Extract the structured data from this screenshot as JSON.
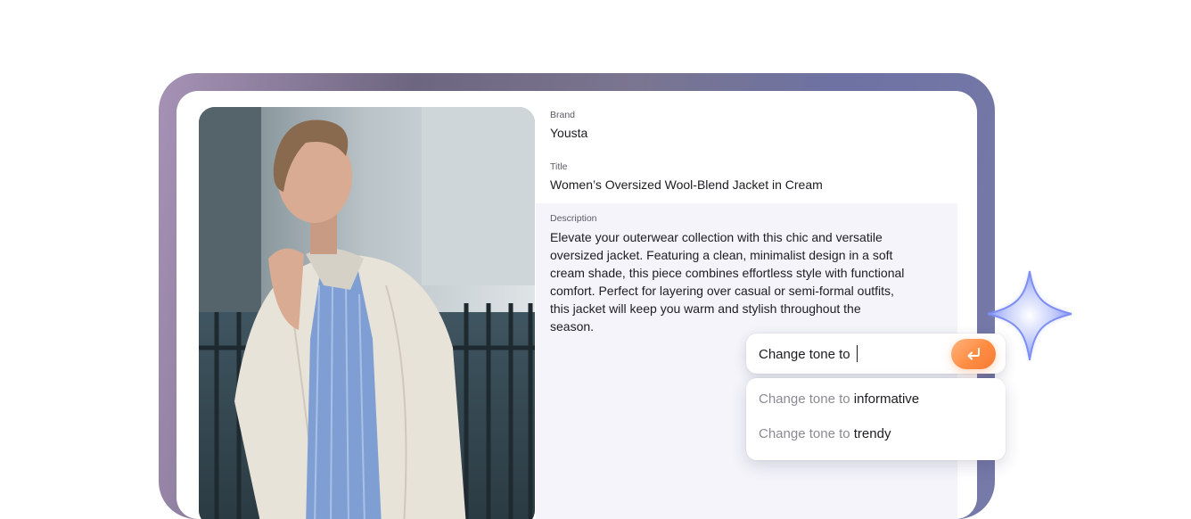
{
  "product": {
    "brand": {
      "label": "Brand",
      "value": "Yousta"
    },
    "title": {
      "label": "Title",
      "value": "Women’s Oversized Wool-Blend Jacket in Cream"
    },
    "description": {
      "label": "Description",
      "value": "Elevate your outerwear collection with this chic and versatile oversized jacket. Featuring a clean, minimalist design in a soft cream shade, this piece combines effortless style with functional comfort. Perfect for layering over casual or semi-formal outfits, this jacket will keep you warm and stylish throughout the season."
    }
  },
  "command": {
    "value": "Change tone to",
    "submit_icon": "return-arrow-icon"
  },
  "suggestions": [
    {
      "prefix": "Change tone to",
      "completion": "informative"
    },
    {
      "prefix": "Change tone to",
      "completion": "trendy"
    }
  ],
  "colors": {
    "accent_orange": "#ff8c42",
    "sparkle_blue": "#6f82f0",
    "panel_bg": "#f4f4fa"
  }
}
